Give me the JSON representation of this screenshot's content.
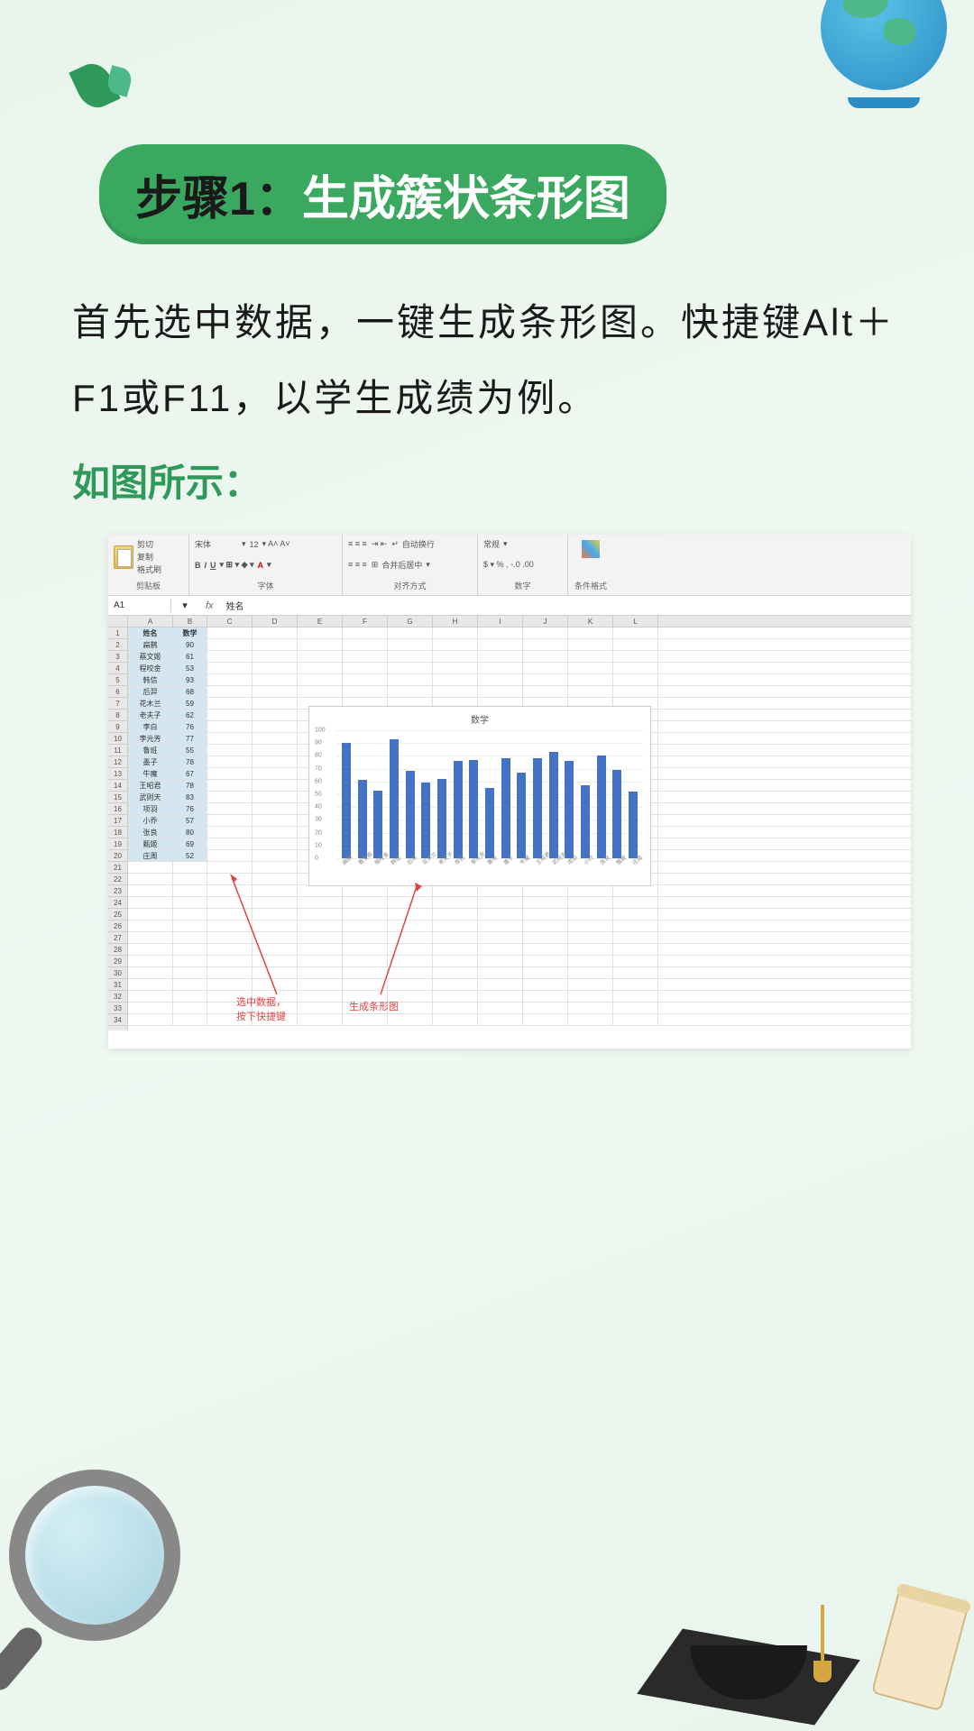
{
  "step": {
    "label": "步骤1：",
    "title": "生成簇状条形图"
  },
  "body": "首先选中数据，一键生成条形图。快捷键Alt＋F1或F11，以学生成绩为例。",
  "caption": "如图所示：",
  "excel": {
    "ribbon": {
      "clipboard": {
        "cut": "剪切",
        "copy": "复制",
        "format": "格式刷",
        "paste": "粘贴",
        "label": "剪贴板"
      },
      "font": {
        "name": "宋体",
        "size": "12",
        "label": "字体"
      },
      "align": {
        "wrap": "自动换行",
        "merge": "合并后居中",
        "label": "对齐方式"
      },
      "number": {
        "style": "常规",
        "label": "数字"
      },
      "cond": "条件格式"
    },
    "namebox": "A1",
    "fx_value": "姓名",
    "columns": [
      "A",
      "B",
      "C",
      "D",
      "E",
      "F",
      "G",
      "H",
      "I",
      "J",
      "K",
      "L"
    ],
    "headers": {
      "name": "姓名",
      "score": "数学"
    },
    "rows": [
      {
        "n": "扁鹊",
        "v": 90
      },
      {
        "n": "蔡文姬",
        "v": 61
      },
      {
        "n": "程咬金",
        "v": 53
      },
      {
        "n": "韩信",
        "v": 93
      },
      {
        "n": "后羿",
        "v": 68
      },
      {
        "n": "花木兰",
        "v": 59
      },
      {
        "n": "老夫子",
        "v": 62
      },
      {
        "n": "李白",
        "v": 76
      },
      {
        "n": "李元芳",
        "v": 77
      },
      {
        "n": "鲁班",
        "v": 55
      },
      {
        "n": "墨子",
        "v": 78
      },
      {
        "n": "牛魔",
        "v": 67
      },
      {
        "n": "王昭君",
        "v": 78
      },
      {
        "n": "武则天",
        "v": 83
      },
      {
        "n": "项羽",
        "v": 76
      },
      {
        "n": "小乔",
        "v": 57
      },
      {
        "n": "张良",
        "v": 80
      },
      {
        "n": "甄姬",
        "v": 69
      },
      {
        "n": "庄周",
        "v": 52
      }
    ],
    "annotation1": "选中数据，\n按下快捷键",
    "annotation2": "生成条形图"
  },
  "chart_data": {
    "type": "bar",
    "title": "数学",
    "xlabel": "",
    "ylabel": "",
    "ylim": [
      0,
      100
    ],
    "yticks": [
      0,
      10,
      20,
      30,
      40,
      50,
      60,
      70,
      80,
      90,
      100
    ],
    "categories": [
      "扁鹊",
      "蔡文姬",
      "程咬金",
      "韩信",
      "后羿",
      "花木兰",
      "老夫子",
      "李白",
      "李元芳",
      "鲁班",
      "墨子",
      "牛魔",
      "王昭君",
      "武则天",
      "项羽",
      "小乔",
      "张良",
      "甄姬",
      "庄周"
    ],
    "values": [
      90,
      61,
      53,
      93,
      68,
      59,
      62,
      76,
      77,
      55,
      78,
      67,
      78,
      83,
      76,
      57,
      80,
      69,
      52
    ]
  }
}
